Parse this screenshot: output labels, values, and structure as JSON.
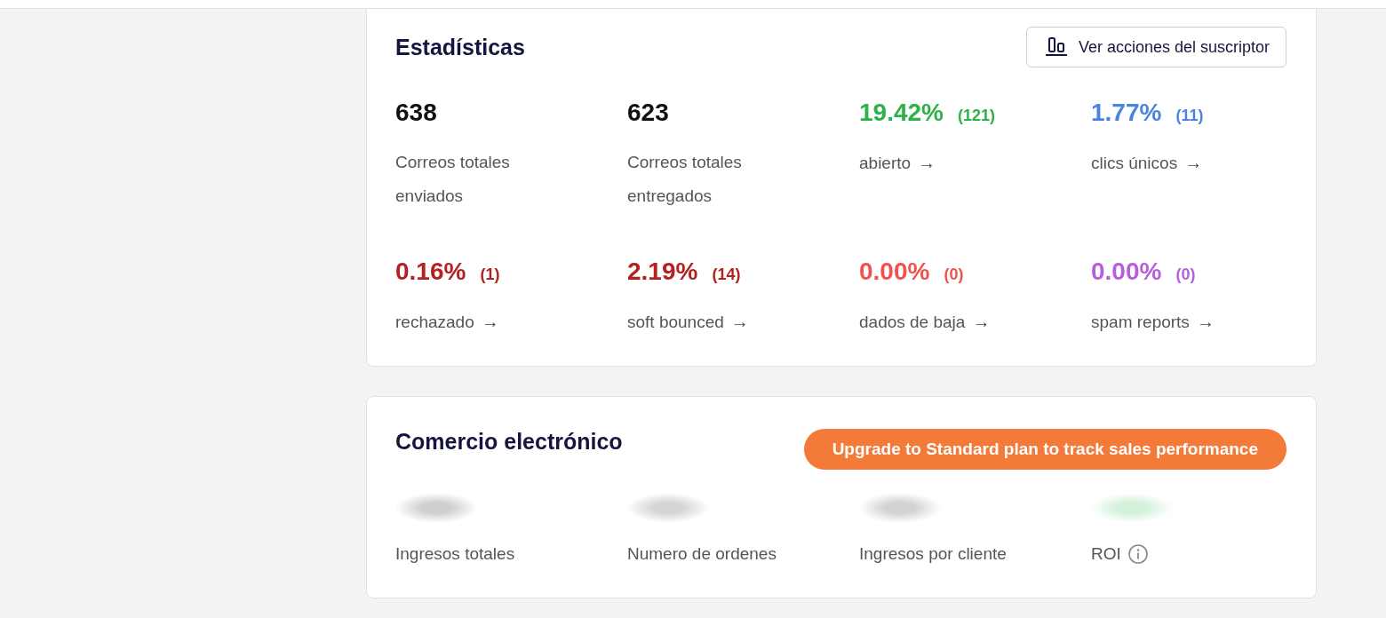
{
  "statistics": {
    "title": "Estadísticas",
    "action_button": {
      "label": "Ver acciones del suscriptor"
    },
    "stats": [
      {
        "value": "638",
        "label": "Correos totales enviados",
        "color": "#111111"
      },
      {
        "value": "623",
        "label": "Correos totales entregados",
        "color": "#111111"
      },
      {
        "value": "19.42%",
        "count": "(121)",
        "label": "abierto",
        "arrow": "→",
        "color": "#2db24a"
      },
      {
        "value": "1.77%",
        "count": "(11)",
        "label": "clics únicos",
        "arrow": "→",
        "color": "#4a84de"
      },
      {
        "value": "0.16%",
        "count": "(1)",
        "label": "rechazado",
        "arrow": "→",
        "color": "#b3221f"
      },
      {
        "value": "2.19%",
        "count": "(14)",
        "label": "soft bounced",
        "arrow": "→",
        "color": "#b3221f"
      },
      {
        "value": "0.00%",
        "count": "(0)",
        "label": "dados de baja",
        "arrow": "→",
        "color": "#f0524c"
      },
      {
        "value": "0.00%",
        "count": "(0)",
        "label": "spam reports",
        "arrow": "→",
        "color": "#b85ddc"
      }
    ]
  },
  "ecommerce": {
    "title": "Comercio electrónico",
    "upgrade_button": {
      "label": "Upgrade to Standard plan to track sales performance"
    },
    "metrics": [
      {
        "label": "Ingresos totales",
        "color": "#cfcfcf",
        "info": false
      },
      {
        "label": "Numero de ordenes",
        "color": "#d4d4d4",
        "info": false
      },
      {
        "label": "Ingresos por cliente",
        "color": "#d2d2d2",
        "info": false
      },
      {
        "label": "ROI",
        "color": "#d3f0d9",
        "info": true
      }
    ]
  }
}
